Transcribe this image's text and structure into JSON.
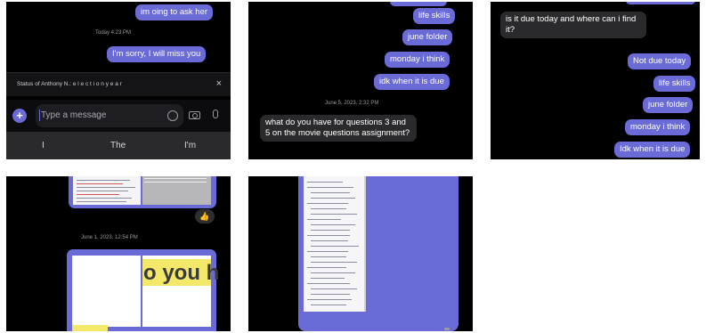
{
  "tile1": {
    "messages": [
      {
        "text": "im oing to ask her",
        "dir": "out"
      },
      {
        "text": "I'm sorry, I will miss you",
        "dir": "out"
      }
    ],
    "timestamp": "Today 4:23 PM",
    "status_bar": "Status of Anthony N.: e l e c t i o n  y e a r",
    "close_glyph": "×",
    "plus_glyph": "+",
    "input_placeholder": "Type a message",
    "suggestions": [
      "I",
      "The",
      "I'm"
    ]
  },
  "tile2": {
    "messages_out": [
      "life skills",
      "june folder",
      "monday i think",
      "idk when it is due"
    ],
    "timestamp": "June 5, 2023, 2:32 PM",
    "incoming": "what do you have for questions 3 and 5 on the movie questions assignment?"
  },
  "tile3": {
    "incoming": "is it due today and where can i find it?",
    "messages_out": [
      "Not due today",
      "life skills",
      "june folder",
      "monday i think",
      "Idk when it is due"
    ]
  },
  "tile4": {
    "timestamp": "June 1, 2023, 12:54 PM",
    "reaction_icon": "thumbs-up-icon",
    "reaction_glyph": "👍",
    "highlight_text": "o you h"
  },
  "tile5": {},
  "colors": {
    "bubble_out": "#6a6bd7",
    "bubble_in": "#2a2a2c",
    "background": "#000000"
  }
}
